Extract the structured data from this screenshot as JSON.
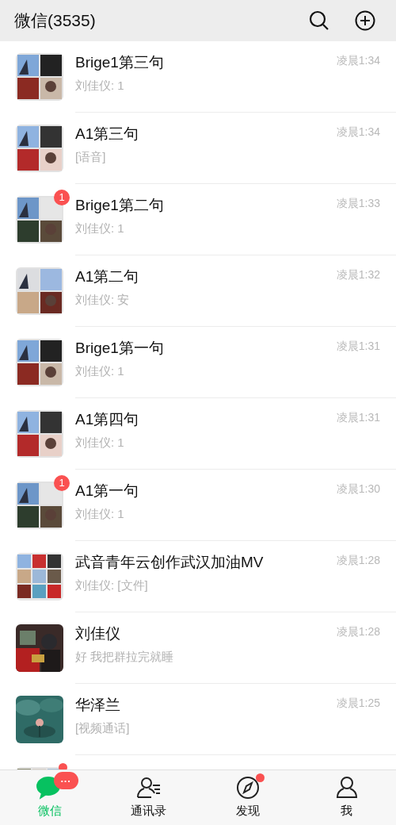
{
  "header": {
    "title": "微信(3535)"
  },
  "chats": [
    {
      "name": "Brige1第三句",
      "preview": "刘佳仪: 1",
      "time": "凌晨1:34"
    },
    {
      "name": "A1第三句",
      "preview": "[语音]",
      "time": "凌晨1:34"
    },
    {
      "name": "Brige1第二句",
      "preview": "刘佳仪: 1",
      "time": "凌晨1:33",
      "badge": "1"
    },
    {
      "name": "A1第二句",
      "preview": "刘佳仪: 安",
      "time": "凌晨1:32"
    },
    {
      "name": "Brige1第一句",
      "preview": "刘佳仪: 1",
      "time": "凌晨1:31"
    },
    {
      "name": "A1第四句",
      "preview": "刘佳仪: 1",
      "time": "凌晨1:31"
    },
    {
      "name": "A1第一句",
      "preview": "刘佳仪: 1",
      "time": "凌晨1:30",
      "badge": "1"
    },
    {
      "name": "武音青年云创作武汉加油MV",
      "preview": "刘佳仪: [文件]",
      "time": "凌晨1:28"
    },
    {
      "name": "刘佳仪",
      "preview": "好 我把群拉完就睡",
      "time": "凌晨1:28"
    },
    {
      "name": "华泽兰",
      "preview": "[视频通话]",
      "time": "凌晨1:25"
    },
    {
      "dot": true
    }
  ],
  "tabs": [
    {
      "kind": "chats",
      "label": "微信",
      "selected": true,
      "badge": "···"
    },
    {
      "kind": "contacts",
      "label": "通讯录",
      "selected": false
    },
    {
      "kind": "discover",
      "label": "发现",
      "selected": false,
      "dot": true
    },
    {
      "kind": "me",
      "label": "我",
      "selected": false
    }
  ]
}
